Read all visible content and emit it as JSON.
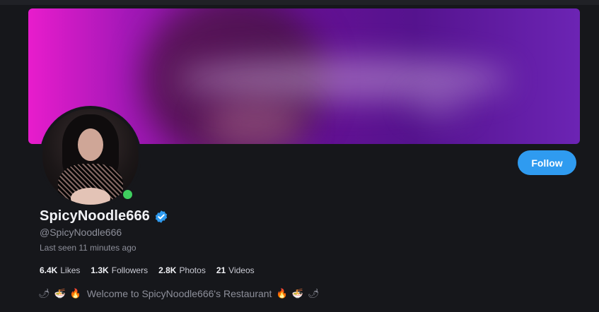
{
  "banner": {
    "accent_start": "#e81ccc",
    "accent_end": "#6c24b4"
  },
  "profile": {
    "display_name": "SpicyNoodle666",
    "handle": "@SpicyNoodle666",
    "last_seen": "Last seen 11 minutes ago",
    "verified_icon": "verified-check-icon",
    "online_status_color": "#3fcf5f"
  },
  "follow": {
    "label": "Follow",
    "color": "#2f9bf0"
  },
  "stats": [
    {
      "value": "6.4K",
      "label": "Likes"
    },
    {
      "value": "1.3K",
      "label": "Followers"
    },
    {
      "value": "2.8K",
      "label": "Photos"
    },
    {
      "value": "21",
      "label": "Videos"
    }
  ],
  "bio": {
    "text": "Welcome to SpicyNoodle666's Restaurant",
    "emoji_left": [
      "🌶",
      "🍜",
      "🔥"
    ],
    "emoji_right": [
      "🔥",
      "🍜",
      "🌶"
    ]
  }
}
